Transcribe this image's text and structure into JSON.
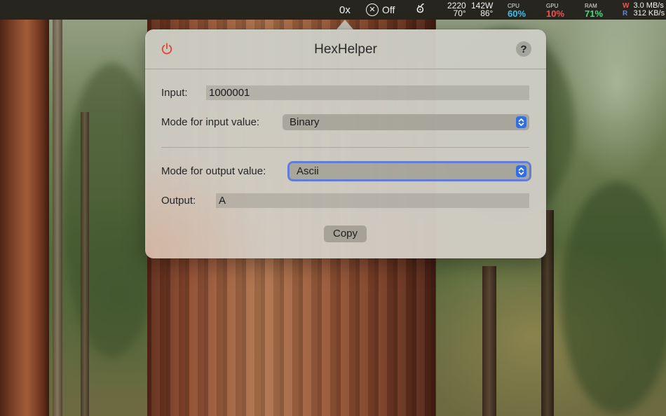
{
  "menubar": {
    "hex_label": "0x",
    "nosleep_status": "Off",
    "temp": {
      "top": "2220",
      "bottom": "70°"
    },
    "power": {
      "top": "142W",
      "bottom": "86°"
    },
    "cpu": {
      "label": "CPU",
      "value": "60%"
    },
    "gpu": {
      "label": "GPU",
      "value": "10%"
    },
    "ram": {
      "label": "RAM",
      "value": "71%"
    },
    "net": {
      "write_label": "W",
      "read_label": "R",
      "write_rate": "3.0 MB/s",
      "read_rate": "312 KB/s"
    }
  },
  "popover": {
    "title": "HexHelper",
    "help_label": "?",
    "input_label": "Input:",
    "input_value": "1000001",
    "input_mode_label": "Mode for input value:",
    "input_mode_value": "Binary",
    "output_mode_label": "Mode for output value:",
    "output_mode_value": "Ascii",
    "output_label": "Output:",
    "output_value": "A",
    "copy_label": "Copy"
  },
  "colors": {
    "accent": "#2f6fe0",
    "power_icon": "#e0452f",
    "cpu_value": "#39c3f0",
    "gpu_value": "#ff4d4d",
    "ram_value": "#3ee07a"
  }
}
